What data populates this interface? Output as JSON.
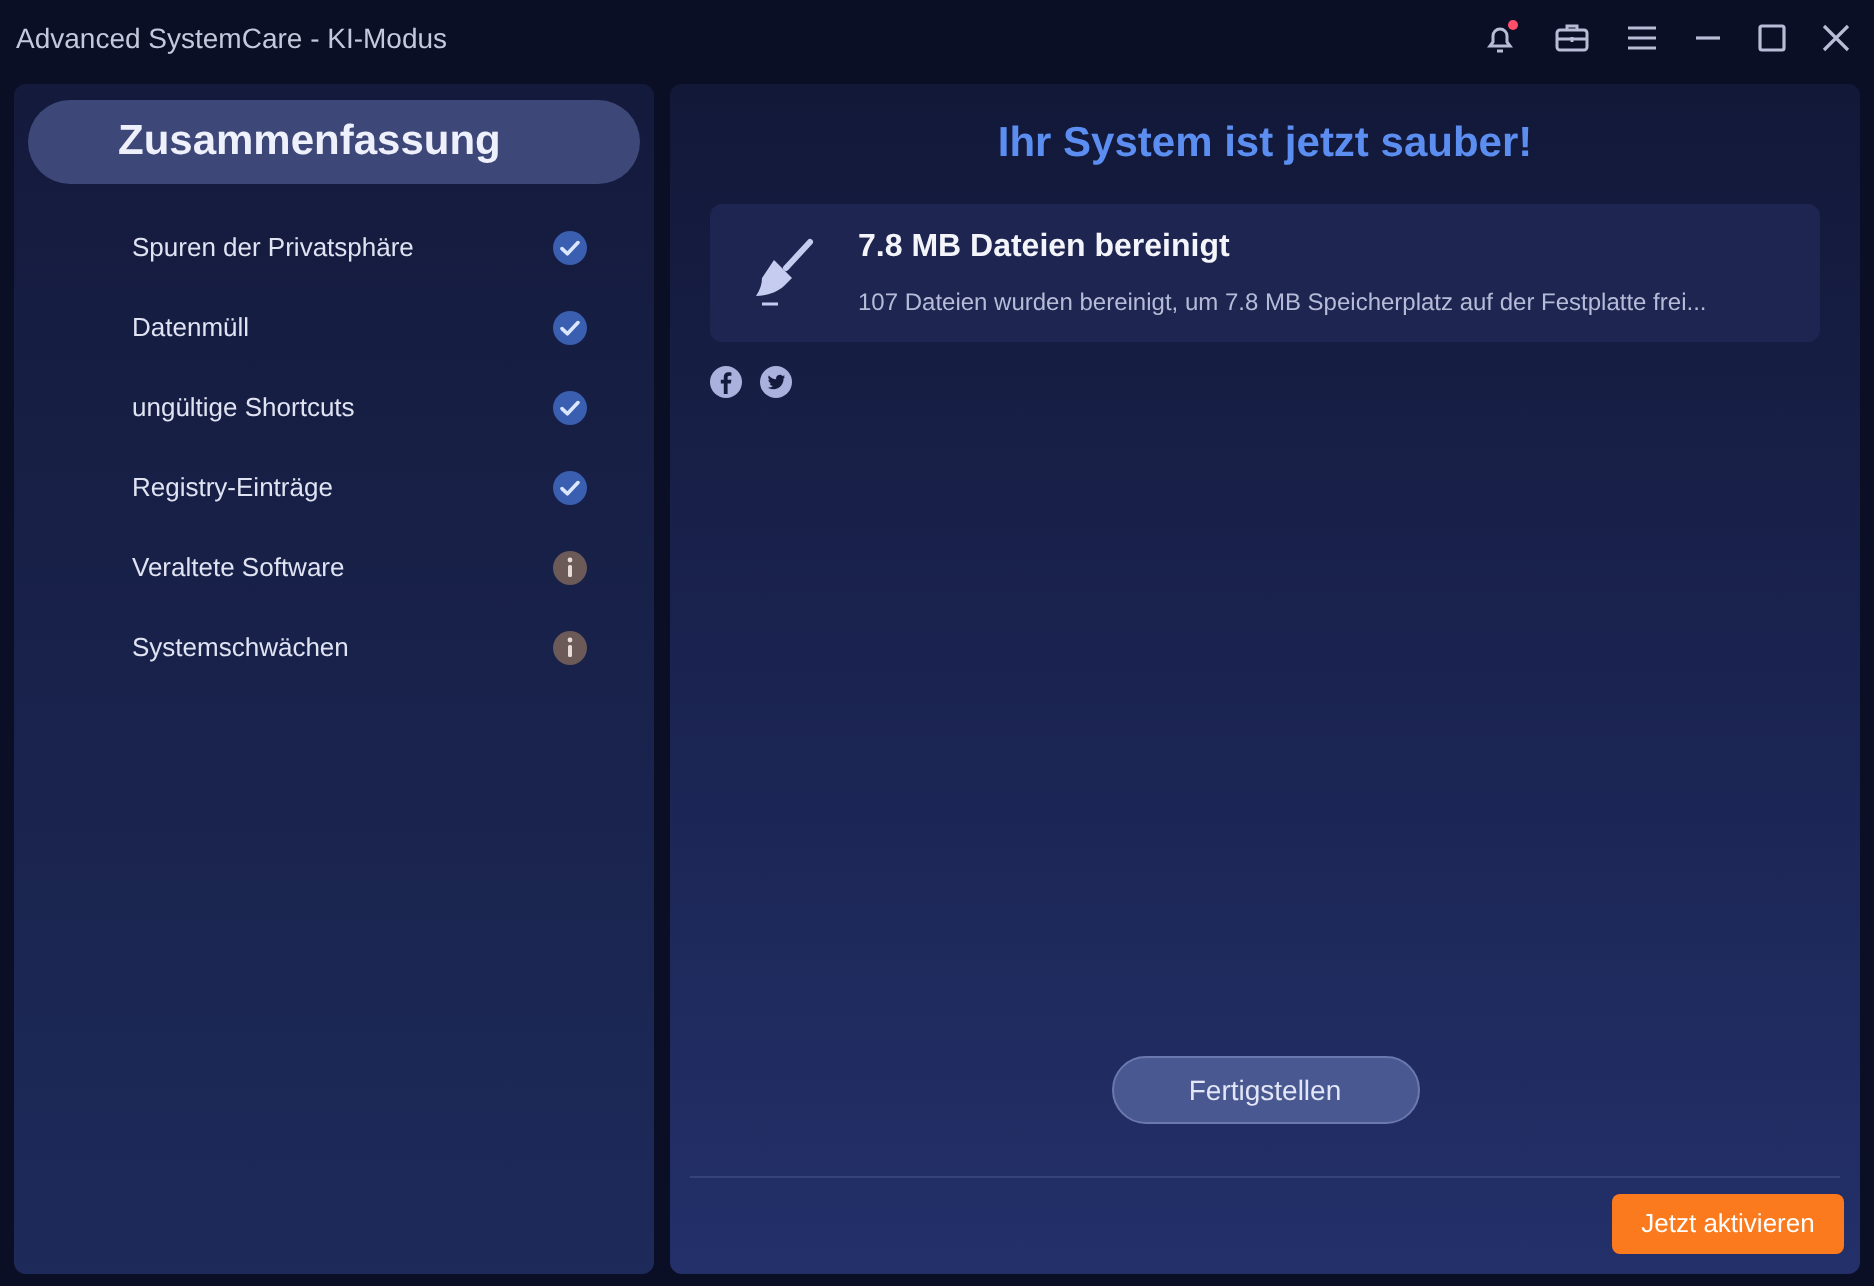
{
  "window": {
    "title": "Advanced SystemCare - KI-Modus",
    "notification": true
  },
  "sidebar": {
    "heading": {
      "label": "Zusammenfassung",
      "selected": true
    },
    "items": [
      {
        "label": "Spuren der Privatsphäre",
        "kind": "done"
      },
      {
        "label": "Datenmüll",
        "kind": "done"
      },
      {
        "label": "ungültige Shortcuts",
        "kind": "done"
      },
      {
        "label": "Registry-Einträge",
        "kind": "done"
      },
      {
        "label": "Veraltete Software",
        "kind": "info"
      },
      {
        "label": "Systemschwächen",
        "kind": "info"
      }
    ]
  },
  "main": {
    "title": "Ihr System ist jetzt sauber!",
    "result": {
      "title": "7.8 MB Dateien bereinigt",
      "detail": "107 Dateien wurden bereinigt, um 7.8 MB Speicherplatz auf der Festplatte frei..."
    },
    "finish_button": "Fertigstellen",
    "activate_button": "Jetzt aktivieren"
  }
}
